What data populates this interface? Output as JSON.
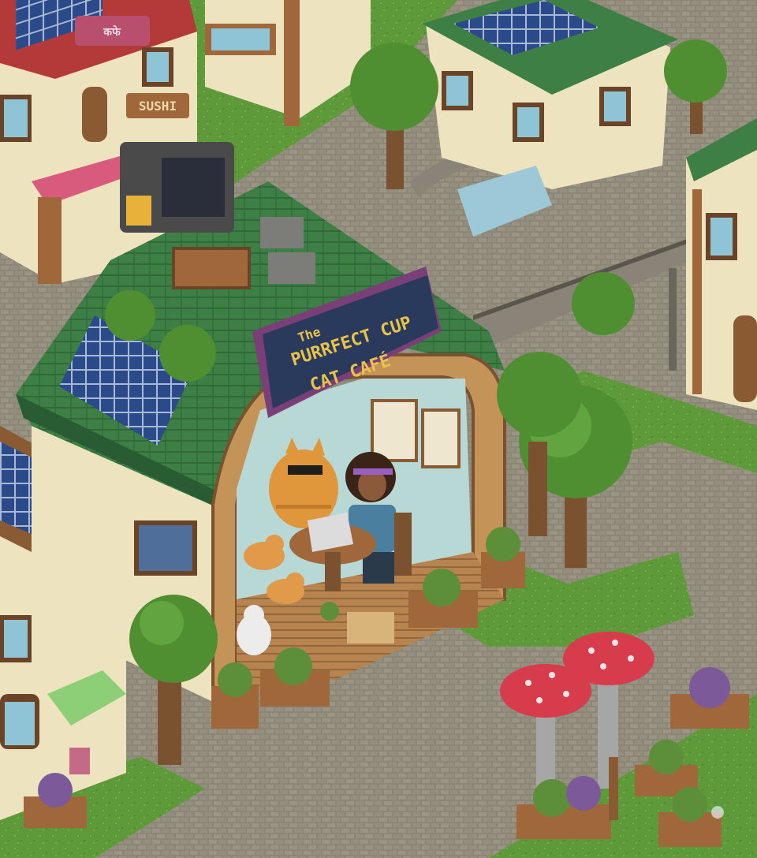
{
  "scene": {
    "type": "isometric pixel-art town",
    "cafe_sign": {
      "line1": "The",
      "line2": "PURRFECT CUP",
      "line3": "CAT CAFÉ"
    },
    "sidewalk_signs": [
      {
        "name": "shop-sign-left",
        "text": "SUSHI"
      },
      {
        "name": "top-sign",
        "text": "कफे"
      }
    ]
  },
  "colors": {
    "grass": "#5f9a3a",
    "grass_dark": "#3f7a2a",
    "cobble": "#8c8676",
    "cobble_dark": "#6e6a5c",
    "roof_green": "#3e7f45",
    "roof_green_dark": "#2a5c33",
    "wall_cream": "#ede3bf",
    "wood": "#a0673a",
    "wood_dark": "#6b4326",
    "sign_bg": "#2a3a5c",
    "sign_border": "#7a3e78",
    "sign_text": "#e8c24a",
    "solar": "#2b4a8a",
    "mushroom_red": "#d63c4c",
    "tree_green": "#4f8f32",
    "cat_orange": "#e0963a"
  }
}
